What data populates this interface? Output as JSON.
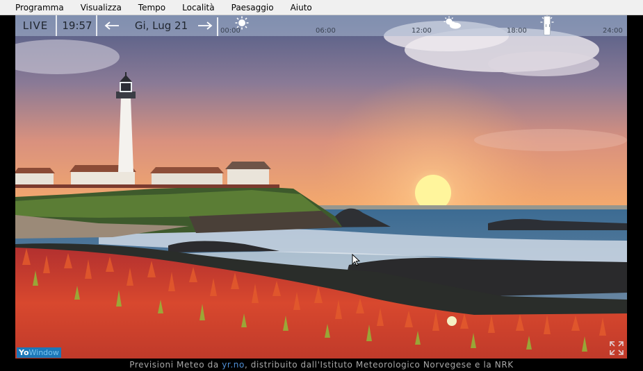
{
  "menu": {
    "items": [
      "Programma",
      "Visualizza",
      "Tempo",
      "Località",
      "Paesaggio",
      "Aiuto"
    ]
  },
  "timebar": {
    "live_label": "LIVE",
    "clock": "19:57",
    "prev_day_icon": "arrow-left-icon",
    "next_day_icon": "arrow-right-icon",
    "date_label": "Gi, Lug 21",
    "hours": [
      "00:00",
      "06:00",
      "12:00",
      "18:00",
      "24:00"
    ],
    "forecast_icons": [
      "sun-icon",
      "sun-cloud-icon",
      "sun-icon"
    ]
  },
  "scene": {
    "description_icon": "lighthouse-sunset-landscape",
    "sky_top": "#5c6790",
    "sky_horizon": "#f3a56e",
    "sun_color": "#fff7a0",
    "sea_color": "#3f6e95"
  },
  "logo": {
    "text_yo": "Yo",
    "text_window": "Window"
  },
  "footer": {
    "prefix": "Previsioni Meteo da",
    "link": "yr.no",
    "suffix": ", distribuito dall'Istituto Meteorologico Norvegese e la NRK"
  }
}
